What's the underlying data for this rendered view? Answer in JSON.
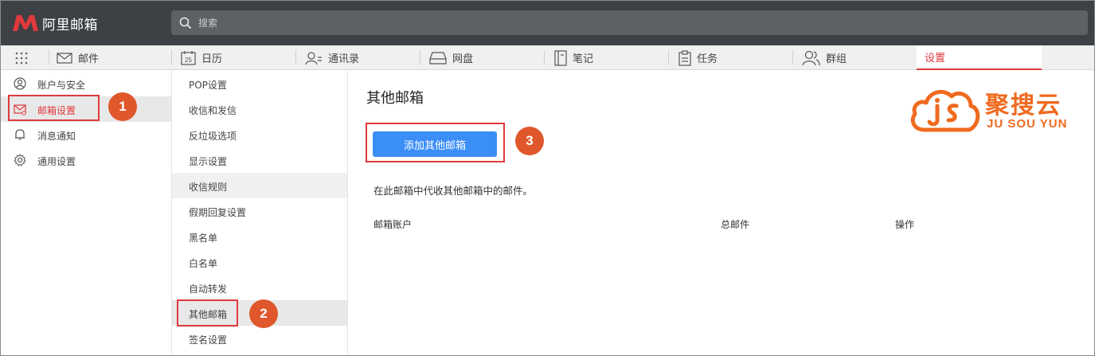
{
  "app": {
    "logo_text": "阿里邮箱"
  },
  "search": {
    "placeholder": "搜索"
  },
  "nav": {
    "items": [
      {
        "label": "邮件",
        "icon": "mail-icon"
      },
      {
        "label": "日历",
        "icon": "calendar-icon",
        "icon_text": "25"
      },
      {
        "label": "通讯录",
        "icon": "contacts-icon"
      },
      {
        "label": "网盘",
        "icon": "drive-icon"
      },
      {
        "label": "笔记",
        "icon": "notes-icon"
      },
      {
        "label": "任务",
        "icon": "tasks-icon"
      },
      {
        "label": "群组",
        "icon": "group-icon"
      },
      {
        "label": "设置",
        "icon": ""
      }
    ],
    "active_color": "#e0393e"
  },
  "sidebar": {
    "items": [
      {
        "label": "账户与安全",
        "icon": "account-icon"
      },
      {
        "label": "邮箱设置",
        "icon": "mail-settings-icon"
      },
      {
        "label": "消息通知",
        "icon": "bell-icon"
      },
      {
        "label": "通用设置",
        "icon": "gear-icon"
      }
    ]
  },
  "settings_list": {
    "items": [
      {
        "label": "POP设置"
      },
      {
        "label": "收信和发信"
      },
      {
        "label": "反垃圾选项"
      },
      {
        "label": "显示设置"
      },
      {
        "label": "收信规则"
      },
      {
        "label": "假期回复设置"
      },
      {
        "label": "黑名单"
      },
      {
        "label": "白名单"
      },
      {
        "label": "自动转发"
      },
      {
        "label": "其他邮箱"
      },
      {
        "label": "签名设置"
      }
    ]
  },
  "main": {
    "title": "其他邮箱",
    "add_button": "添加其他邮箱",
    "description": "在此邮箱中代收其他邮箱中的邮件。",
    "table": {
      "headers": [
        "邮箱账户",
        "总邮件",
        "操作"
      ]
    }
  },
  "callouts": {
    "badge1": "1",
    "badge2": "2",
    "badge3": "3"
  },
  "brand": {
    "name_cn": "聚搜云",
    "name_en": "JU SOU YUN",
    "color": "#ef6a1f"
  },
  "colors": {
    "topbar": "#3d4044",
    "accent": "#e0393e",
    "button": "#3c8ef7",
    "badge": "#e0572c"
  }
}
